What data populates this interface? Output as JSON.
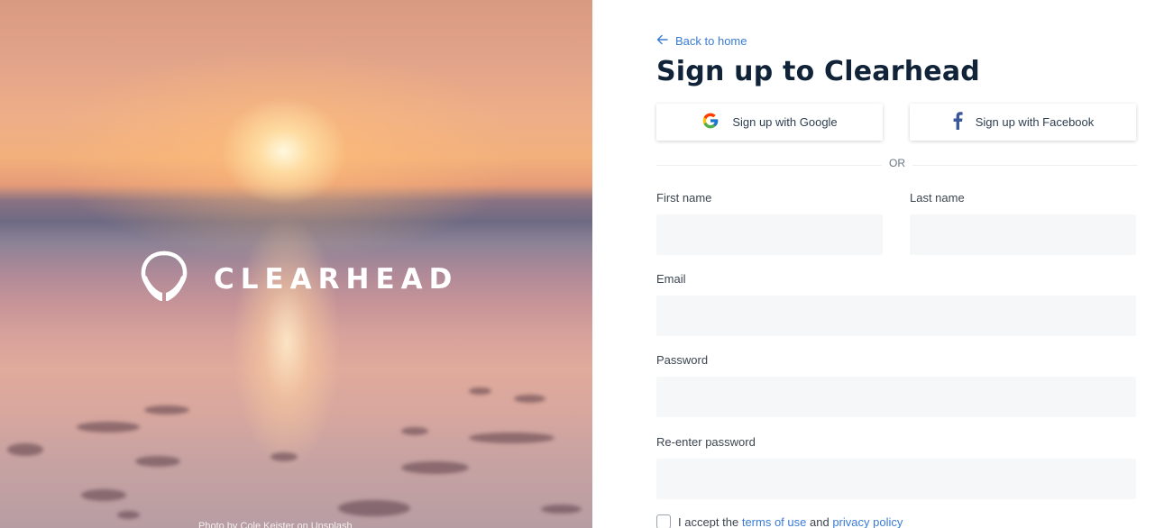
{
  "hero": {
    "logo_text": "CLEARHEAD",
    "photo_credit": "Photo by Cole Keister on Unsplash"
  },
  "form": {
    "back_link": "Back to home",
    "title": "Sign up to Clearhead",
    "google_button": "Sign up with Google",
    "facebook_button": "Sign up with Facebook",
    "or_divider": "OR",
    "first_name_label": "First name",
    "last_name_label": "Last name",
    "email_label": "Email",
    "password_label": "Password",
    "reenter_password_label": "Re-enter password",
    "first_name_value": "",
    "last_name_value": "",
    "email_value": "",
    "password_value": "",
    "reenter_password_value": "",
    "accept_prefix": "I accept the",
    "terms_link": "terms of use",
    "accept_and": "and",
    "privacy_link": "privacy policy"
  },
  "colors": {
    "accent": "#3a7bd5",
    "title": "#112338",
    "input_bg": "#f6f7f9"
  },
  "icons": {
    "back": "arrow-left-icon",
    "google": "google-icon",
    "facebook": "facebook-icon",
    "logo": "head-hands-icon"
  }
}
